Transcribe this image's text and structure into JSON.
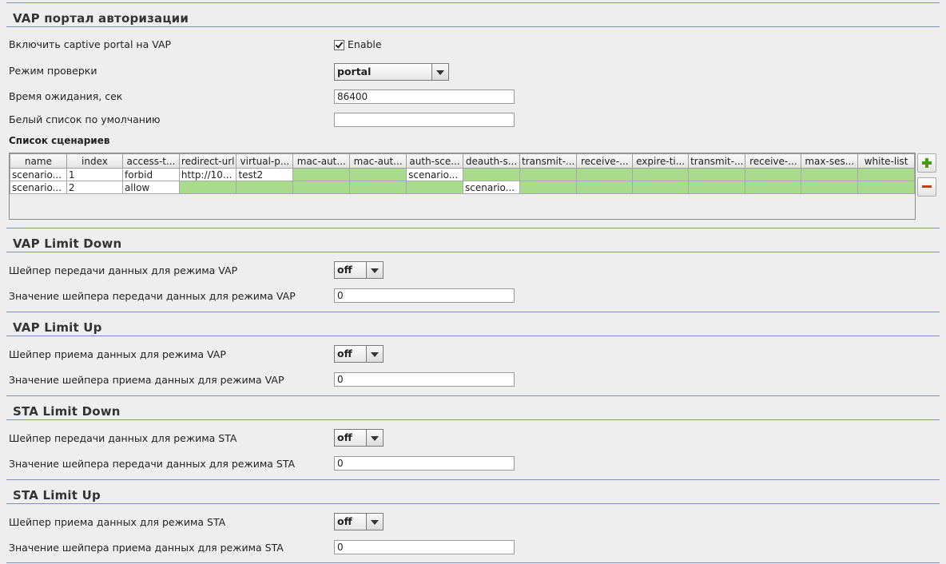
{
  "portal": {
    "title": "VAP портал авторизации",
    "enable_label": "Включить captive portal на VAP",
    "enable_checkbox_label": "Enable",
    "enable_checked": true,
    "mode_label": "Режим проверки",
    "mode_value": "portal",
    "timeout_label": "Время ожидания, сек",
    "timeout_value": "86400",
    "whitelist_label": "Белый список по умолчанию",
    "whitelist_value": "",
    "scenarios_label": "Список сценариев"
  },
  "table": {
    "columns": [
      "name",
      "index",
      "access-t...",
      "redirect-url",
      "virtual-p...",
      "mac-aut...",
      "mac-aut...",
      "auth-sce...",
      "deauth-s...",
      "transmit-...",
      "receive-...",
      "expire-ti...",
      "transmit-...",
      "receive-...",
      "max-ses...",
      "white-list"
    ],
    "rows": [
      [
        "scenario...",
        "1",
        "forbid",
        "http://10...",
        "test2",
        "",
        "",
        "scenario...",
        "",
        "",
        "",
        "",
        "",
        "",
        "",
        ""
      ],
      [
        "scenario...",
        "2",
        "allow",
        "",
        "",
        "",
        "",
        "",
        "scenario...",
        "",
        "",
        "",
        "",
        "",
        "",
        ""
      ]
    ]
  },
  "vap_down": {
    "title": "VAP Limit Down",
    "shaper_label": "Шейпер передачи данных для режима VAP",
    "shaper_value": "off",
    "value_label": "Значение шейпера передачи данных для режима VAP",
    "value": "0"
  },
  "vap_up": {
    "title": "VAP Limit Up",
    "shaper_label": "Шейпер приема данных для режима VAP",
    "shaper_value": "off",
    "value_label": "Значение шейпера приема данных для режима VAP",
    "value": "0"
  },
  "sta_down": {
    "title": "STA Limit Down",
    "shaper_label": "Шейпер передачи данных для режима STA",
    "shaper_value": "off",
    "value_label": "Значение шейпера передачи данных для режима STA",
    "value": "0"
  },
  "sta_up": {
    "title": "STA Limit Up",
    "shaper_label": "Шейпер приема данных для режима STA",
    "shaper_value": "off",
    "value_label": "Значение шейпера приема данных для режима STA",
    "value": "0"
  },
  "colors": {
    "accent_line": "#7d8fb3",
    "empty_cell": "#a8dc8c",
    "add_icon": "#4a9a1a",
    "remove_icon": "#b8441c"
  }
}
